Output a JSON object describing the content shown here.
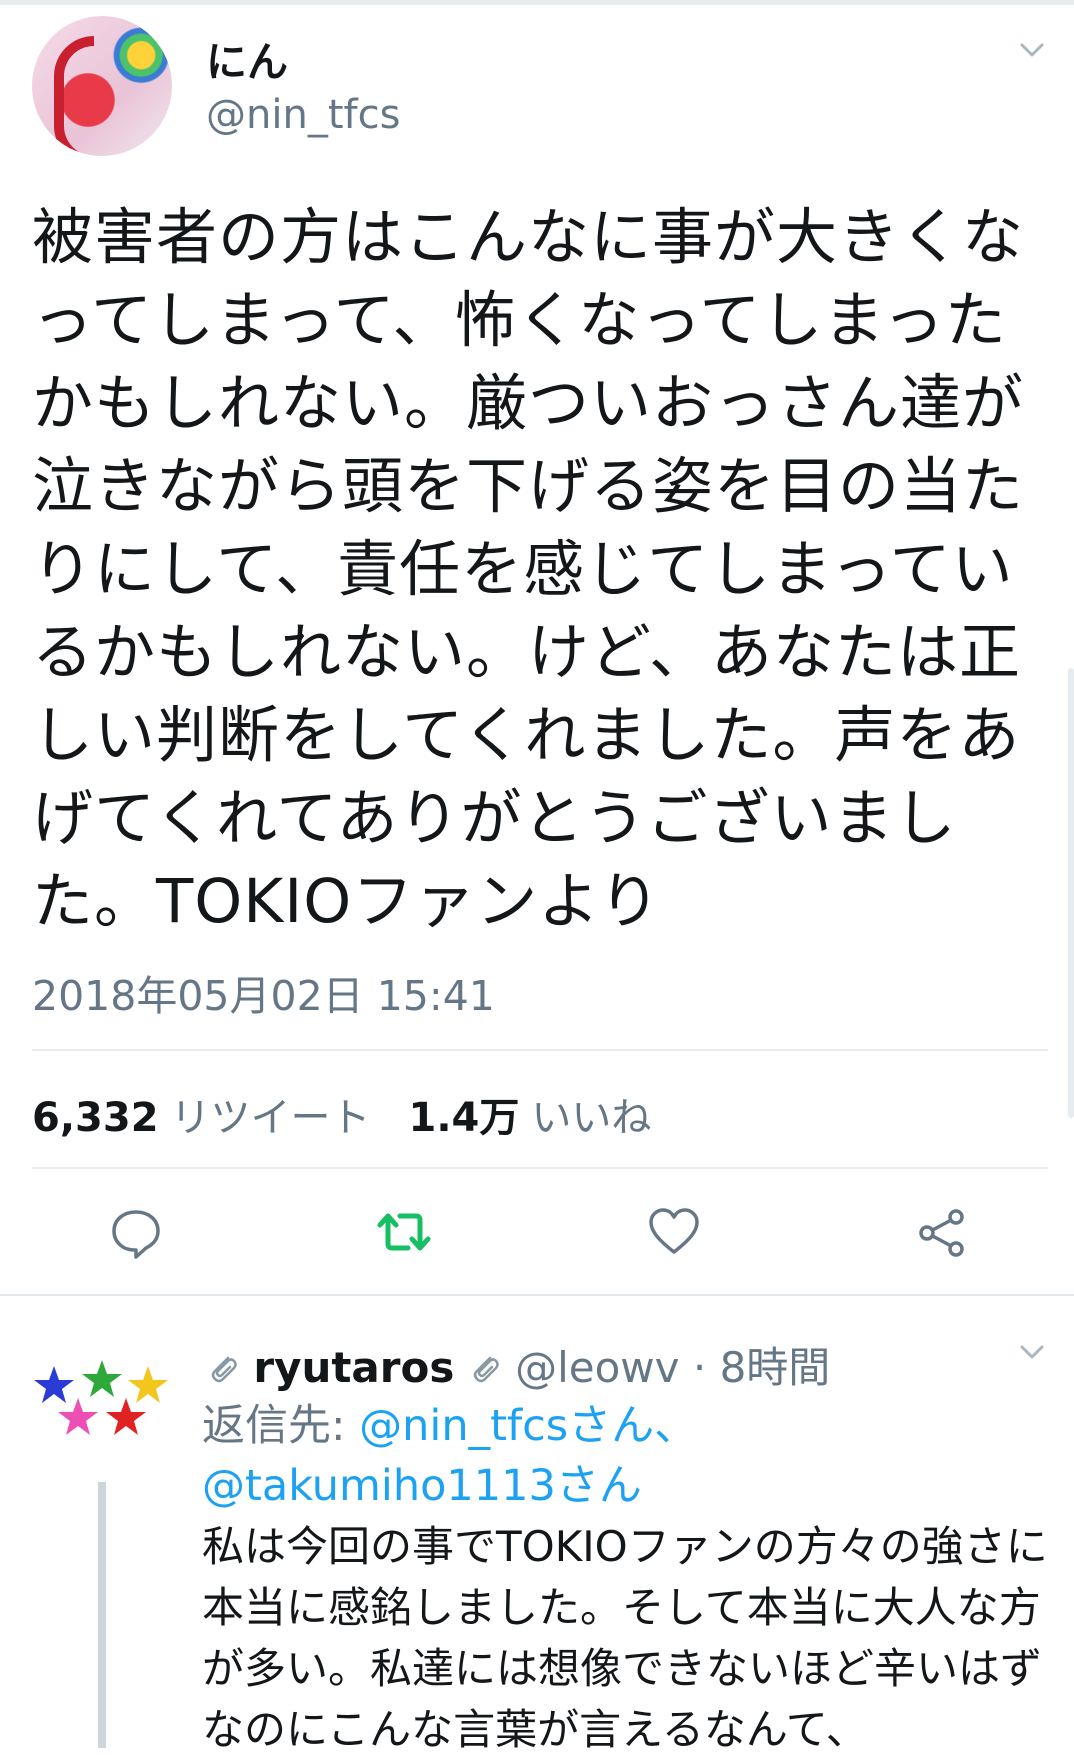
{
  "tweet": {
    "display_name": "にん",
    "handle": "@nin_tfcs",
    "text": "被害者の方はこんなに事が大きくなってしまって、怖くなってしまったかもしれない。厳ついおっさん達が泣きながら頭を下げる姿を目の当たりにして、責任を感じてしまっているかもしれない。けど、あなたは正しい判断をしてくれました。声をあげてくれてありがとうございました。TOKIOファンより",
    "timestamp": "2018年05月02日 15:41",
    "retweet_count": "6,332",
    "retweet_label": "リツイート",
    "like_count": "1.4万",
    "like_label": "いいね"
  },
  "actions": {
    "reply": "reply-icon",
    "retweet": "retweet-icon",
    "like": "heart-icon",
    "share": "share-icon"
  },
  "reply": {
    "display_name": "ryutaros",
    "handle": "@leowv",
    "separator": "·",
    "time": "8時間",
    "reply_prefix": "返信先: ",
    "mention1": "@nin_tfcsさん、",
    "mention2": "@takumiho1113さん",
    "text": "私は今回の事でTOKIOファンの方々の強さに本当に感銘しました。そして本当に大人な方が多い。私達には想像できないほど辛いはずなのにこんな言葉が言えるなんて、"
  },
  "colors": {
    "text": "#14171a",
    "secondary": "#657786",
    "link": "#1da1f2",
    "retweet_active": "#17bf63"
  }
}
